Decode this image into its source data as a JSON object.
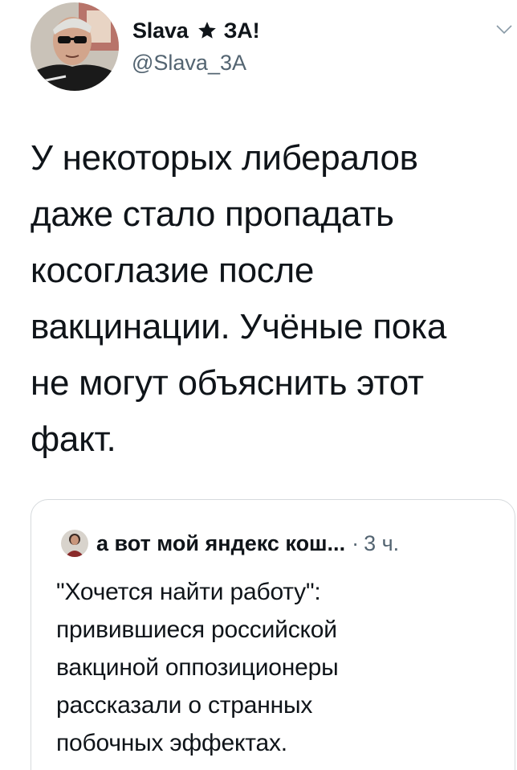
{
  "author": {
    "display_name": "Slava",
    "badge_icon": "star-icon",
    "name_suffix": "ЗА!",
    "handle": "@Slava_3A"
  },
  "tweet": {
    "lines": [
      "У некоторых либералов",
      "даже стало пропадать",
      "косоглазие после",
      "вакцинации. Учёные пока",
      "не могут объяснить этот",
      "факт."
    ]
  },
  "quoted_tweet": {
    "author_name": "а вот мой яндекс кош...",
    "separator": "·",
    "time": "3 ч.",
    "lines": [
      "\"Хочется найти работу\":",
      "привившиеся российской",
      "вакциной оппозиционеры",
      "рассказали о странных",
      "побочных эффектах."
    ]
  },
  "icons": {
    "menu": "chevron-down-icon",
    "avatar": "avatar",
    "quote_avatar": "quote-avatar"
  },
  "colors": {
    "text_primary": "#0f1419",
    "text_secondary": "#536471",
    "border": "#d6dadd"
  }
}
